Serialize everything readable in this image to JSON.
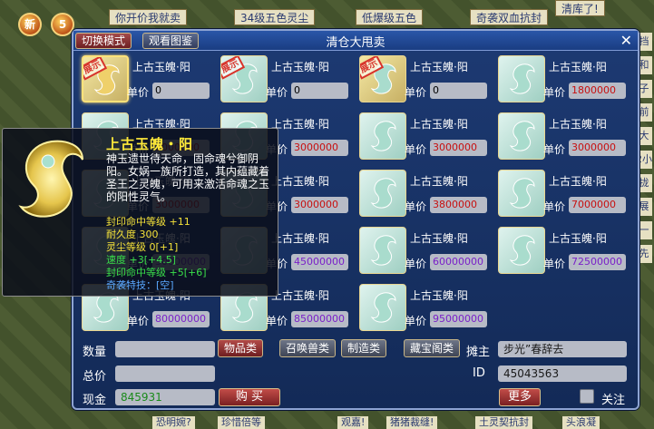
{
  "background": {
    "top_tags": [
      "你开价我就卖",
      "34级五色灵尘",
      "低爆级五色",
      "奇袭双血抗封",
      "清库了!",
      "清库了"
    ],
    "bottom_tags": [
      "恐明婉?",
      "珍惜倍等",
      "观嘉!",
      "猪猪裁缝!",
      "土灵契抗封",
      "头浪凝"
    ],
    "right_tags": [
      "挡",
      "和",
      "子",
      "前",
      "大",
      "2小",
      "拢",
      "展",
      "一",
      "先"
    ],
    "left_buttons": [
      "新",
      "5"
    ]
  },
  "panel": {
    "title": "清仓大甩卖",
    "tab_switch_label": "切换模式",
    "tab_view_label": "观看图鉴",
    "close_glyph": "✕"
  },
  "item_common": {
    "name": "上古玉魄·阳",
    "price_label": "单价",
    "stamp": "展示"
  },
  "items": [
    {
      "price": "0",
      "stamp": true,
      "selected": true,
      "price_color": "#000000"
    },
    {
      "price": "0",
      "stamp": true,
      "selected": false,
      "price_color": "#000000"
    },
    {
      "price": "0",
      "stamp": true,
      "selected": false,
      "price_color": "#000000"
    },
    {
      "price": "1800000",
      "stamp": false,
      "selected": false,
      "price_color": "#c81010"
    },
    {
      "price": "3000000",
      "stamp": false,
      "selected": false,
      "price_color": "#c81010"
    },
    {
      "price": "3000000",
      "stamp": false,
      "selected": false,
      "price_color": "#c81010"
    },
    {
      "price": "3000000",
      "stamp": false,
      "selected": false,
      "price_color": "#c81010"
    },
    {
      "price": "3000000",
      "stamp": false,
      "selected": false,
      "price_color": "#c81010"
    },
    {
      "price": "3000000",
      "stamp": false,
      "selected": false,
      "price_color": "#c81010"
    },
    {
      "price": "3000000",
      "stamp": false,
      "selected": false,
      "price_color": "#c81010"
    },
    {
      "price": "3800000",
      "stamp": false,
      "selected": false,
      "price_color": "#c81010"
    },
    {
      "price": "7000000",
      "stamp": false,
      "selected": false,
      "price_color": "#c81010"
    },
    {
      "price": "30000000",
      "stamp": false,
      "selected": false,
      "price_color": "#7a20c8"
    },
    {
      "price": "45000000",
      "stamp": false,
      "selected": false,
      "price_color": "#7a20c8"
    },
    {
      "price": "60000000",
      "stamp": false,
      "selected": false,
      "price_color": "#7a20c8"
    },
    {
      "price": "72500000",
      "stamp": false,
      "selected": false,
      "price_color": "#7a20c8"
    },
    {
      "price": "80000000",
      "stamp": false,
      "selected": false,
      "price_color": "#7a20c8"
    },
    {
      "price": "85000000",
      "stamp": false,
      "selected": false,
      "price_color": "#7a20c8"
    },
    {
      "price": "95000000",
      "stamp": false,
      "selected": false,
      "price_color": "#7a20c8"
    }
  ],
  "bottom": {
    "quantity_label": "数量",
    "quantity_value": "",
    "total_label": "总价",
    "total_value": "",
    "cash_label": "现金",
    "cash_value": "845931",
    "buy_label": "购 买",
    "categories": [
      "物品类",
      "召唤兽类",
      "制造类",
      "藏宝阁类"
    ],
    "active_category": 0,
    "seller_label": "摊主",
    "seller_value": "步光”春辞去",
    "id_label": "ID",
    "id_value": "45043563",
    "more_label": "更多",
    "follow_label": "关注"
  },
  "tooltip": {
    "title": "上古玉魄・阳",
    "description": "神玉遗世待天命，固命魂兮御阴阳。女娲一族所打造，其内蕴藏着圣王之灵魄，可用来激活命魂之玉的阳性灵气。",
    "lines": [
      {
        "text": "封印命中等级 +11",
        "color": "#f5e23a"
      },
      {
        "text": "耐久度 300",
        "color": "#f5e23a"
      },
      {
        "text": "灵尘等级 0[+1]",
        "color": "#f5e23a"
      },
      {
        "text": "速度 +3[+4.5]",
        "color": "#3adf4a"
      },
      {
        "text": "封印命中等级 +5[+6]",
        "color": "#3adf4a"
      },
      {
        "text": "奇袭特技：[空]",
        "color": "#5aa8ff"
      }
    ]
  }
}
